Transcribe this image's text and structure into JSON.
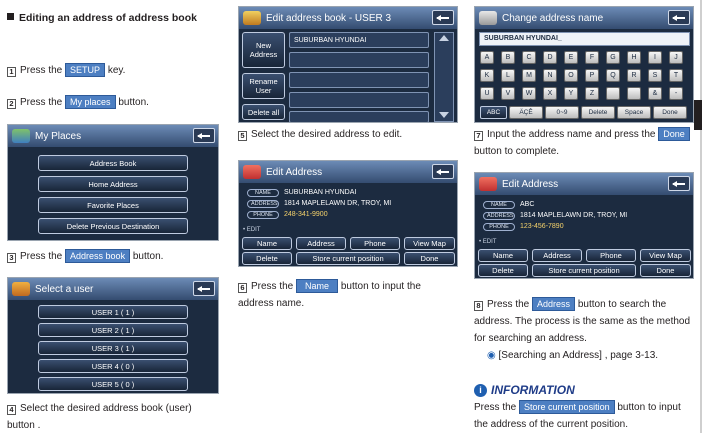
{
  "col1": {
    "heading": "Editing an address of address book",
    "step1": {
      "num": "1",
      "pre": "Press the ",
      "key": "SETUP",
      "post": " key."
    },
    "step2": {
      "num": "2",
      "pre": "Press the ",
      "key": "My places",
      "post": " button."
    },
    "myplaces": {
      "title": "My Places",
      "buttons": [
        "Address Book",
        "Home Address",
        "Favorite Places",
        "Delete Previous Destination"
      ]
    },
    "step3": {
      "num": "3",
      "pre": "Press the ",
      "key": "Address book",
      "post": " button."
    },
    "selectuser": {
      "title": "Select a user",
      "users": [
        "USER 1 ( 1 )",
        "USER 2 ( 1 )",
        "USER 3 ( 1 )",
        "USER 4 ( 0 )",
        "USER 5 ( 0 )"
      ]
    },
    "step4": {
      "num": "4",
      "text": "Select the desired address book (user) button ."
    }
  },
  "col2": {
    "editbook": {
      "title": "Edit address book - USER 3",
      "new_address": "New Address",
      "rename_user": "Rename User",
      "delete_all": "Delete all",
      "entry": "SUBURBAN HYUNDAI"
    },
    "step5": {
      "num": "5",
      "text": "Select the desired address to edit."
    },
    "editaddr": {
      "title": "Edit Address",
      "name_tag": "NAME",
      "address_tag": "ADDRESS",
      "phone_tag": "PHONE",
      "name": "SUBURBAN HYUNDAI",
      "address": "1814 MAPLELAWN DR, TROY, MI",
      "phone": "248-341-9900",
      "edit_label": "EDIT",
      "buttons": [
        "Name",
        "Address",
        "Phone",
        "View Map"
      ],
      "delete": "Delete",
      "store": "Store current position",
      "done": "Done"
    },
    "step6": {
      "num": "6",
      "pre": "Press the ",
      "key": "Name",
      "post": " button to input the address name."
    }
  },
  "col3": {
    "changename": {
      "title": "Change address name",
      "input": "SUBURBAN HYUNDAI_",
      "rows": [
        [
          "A",
          "B",
          "C",
          "D",
          "E",
          "F",
          "G",
          "H",
          "I",
          "J"
        ],
        [
          "K",
          "L",
          "M",
          "N",
          "O",
          "P",
          "Q",
          "R",
          "S",
          "T"
        ],
        [
          "U",
          "V",
          "W",
          "X",
          "Y",
          "Z",
          "",
          "",
          "&",
          "-"
        ]
      ],
      "bottom": [
        "ABC",
        "ÄÇÊ",
        "0~9",
        "Delete",
        "Space",
        "Done"
      ]
    },
    "step7": {
      "num": "7",
      "pre": "Input the address name and press the ",
      "key": "Done",
      "post": " button to complete."
    },
    "editaddr2": {
      "title": "Edit Address",
      "name_tag": "NAME",
      "address_tag": "ADDRESS",
      "phone_tag": "PHONE",
      "name": "ABC",
      "address": "1814 MAPLELAWN DR, TROY, MI",
      "phone": "123-456-7890",
      "edit_label": "EDIT",
      "buttons": [
        "Name",
        "Address",
        "Phone",
        "View Map"
      ],
      "delete": "Delete",
      "store": "Store current position",
      "done": "Done"
    },
    "step8": {
      "num": "8",
      "pre": "Press the ",
      "key": "Address",
      "post": " button to search the address. The process is the same as the method for searching an address.",
      "ref": "[Searching an Address] , page 3-13."
    },
    "info": {
      "title": "INFORMATION",
      "pre": "Press the ",
      "key": "Store current position",
      "post": " button to input the address of the current position."
    }
  }
}
